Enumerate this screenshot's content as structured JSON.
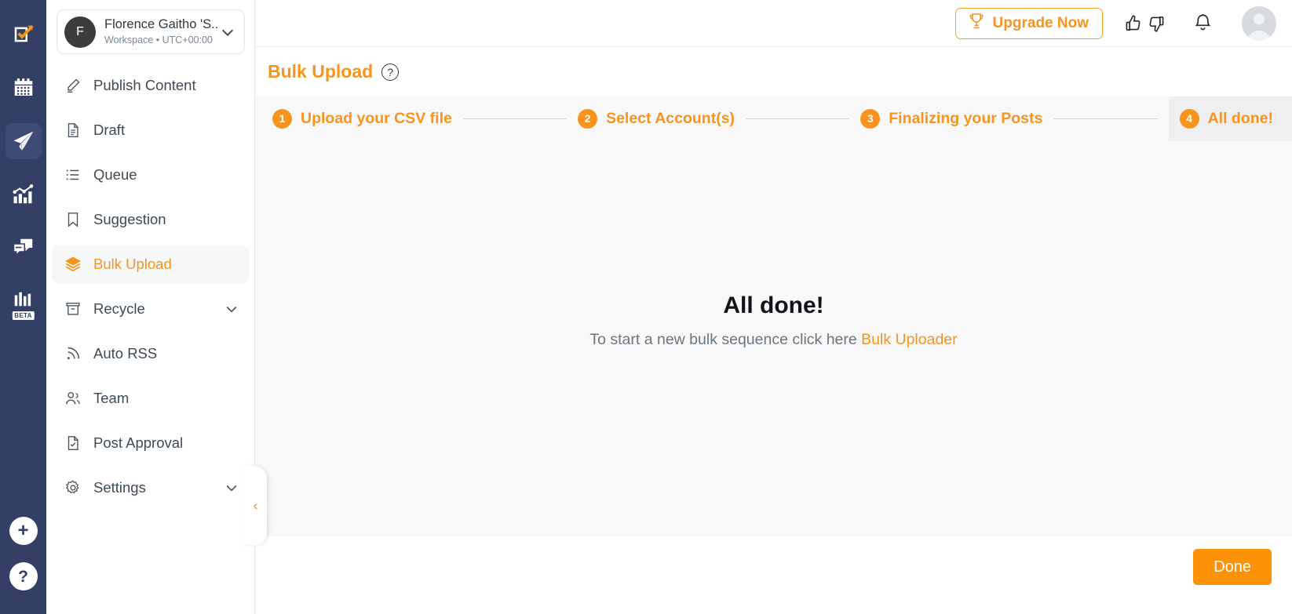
{
  "rail": {
    "items": [
      {
        "name": "compose-icon",
        "label": "Compose"
      },
      {
        "name": "calendar-icon",
        "label": "Calendar"
      },
      {
        "name": "publish-icon",
        "label": "Publish"
      },
      {
        "name": "analytics-icon",
        "label": "Analytics"
      },
      {
        "name": "inbox-icon",
        "label": "Inbox"
      },
      {
        "name": "reports-icon",
        "label": "Reports",
        "badge": "BETA"
      }
    ],
    "badge_text": "BETA",
    "add_label": "+",
    "help_label": "?"
  },
  "workspace": {
    "initial": "F",
    "name": "Florence Gaitho 'S...",
    "subtitle": "Workspace • UTC+00:00",
    "chevron": "chevron-down"
  },
  "sidebar": {
    "items": [
      {
        "label": "Publish Content",
        "icon": "pencil-icon",
        "active": false,
        "expandable": false
      },
      {
        "label": "Draft",
        "icon": "document-icon",
        "active": false,
        "expandable": false
      },
      {
        "label": "Queue",
        "icon": "list-icon",
        "active": false,
        "expandable": false
      },
      {
        "label": "Suggestion",
        "icon": "bookmark-icon",
        "active": false,
        "expandable": false
      },
      {
        "label": "Bulk Upload",
        "icon": "layers-icon",
        "active": true,
        "expandable": false
      },
      {
        "label": "Recycle",
        "icon": "archive-icon",
        "active": false,
        "expandable": true
      },
      {
        "label": "Auto RSS",
        "icon": "rss-icon",
        "active": false,
        "expandable": false
      },
      {
        "label": "Team",
        "icon": "users-icon",
        "active": false,
        "expandable": false
      },
      {
        "label": "Post Approval",
        "icon": "document-check-icon",
        "active": false,
        "expandable": false
      },
      {
        "label": "Settings",
        "icon": "gear-icon",
        "active": false,
        "expandable": true
      }
    ],
    "collapse_label": "‹"
  },
  "topbar": {
    "upgrade_label": "Upgrade Now",
    "trophy_icon": "trophy-icon",
    "thumbs_up_icon": "thumbs-up-icon",
    "thumbs_down_icon": "thumbs-down-icon",
    "bell_icon": "bell-icon",
    "avatar_icon": "user-avatar"
  },
  "page": {
    "title": "Bulk Upload",
    "help_glyph": "?"
  },
  "stepper": {
    "steps": [
      {
        "number": "1",
        "label": "Upload your CSV file",
        "highlight": false
      },
      {
        "number": "2",
        "label": "Select Account(s)",
        "highlight": false
      },
      {
        "number": "3",
        "label": "Finalizing your Posts",
        "highlight": false
      },
      {
        "number": "4",
        "label": "All done!",
        "highlight": true
      }
    ]
  },
  "main": {
    "done_title": "All done!",
    "done_sub_prefix": "To start a new bulk sequence click here ",
    "done_link": "Bulk Uploader"
  },
  "footer": {
    "done_button": "Done"
  },
  "colors": {
    "accent": "#f7941e",
    "rail_bg": "#333f65",
    "content_bg": "#f8f8f8",
    "step_highlight": "#efefef",
    "done_button": "#fb9208"
  }
}
